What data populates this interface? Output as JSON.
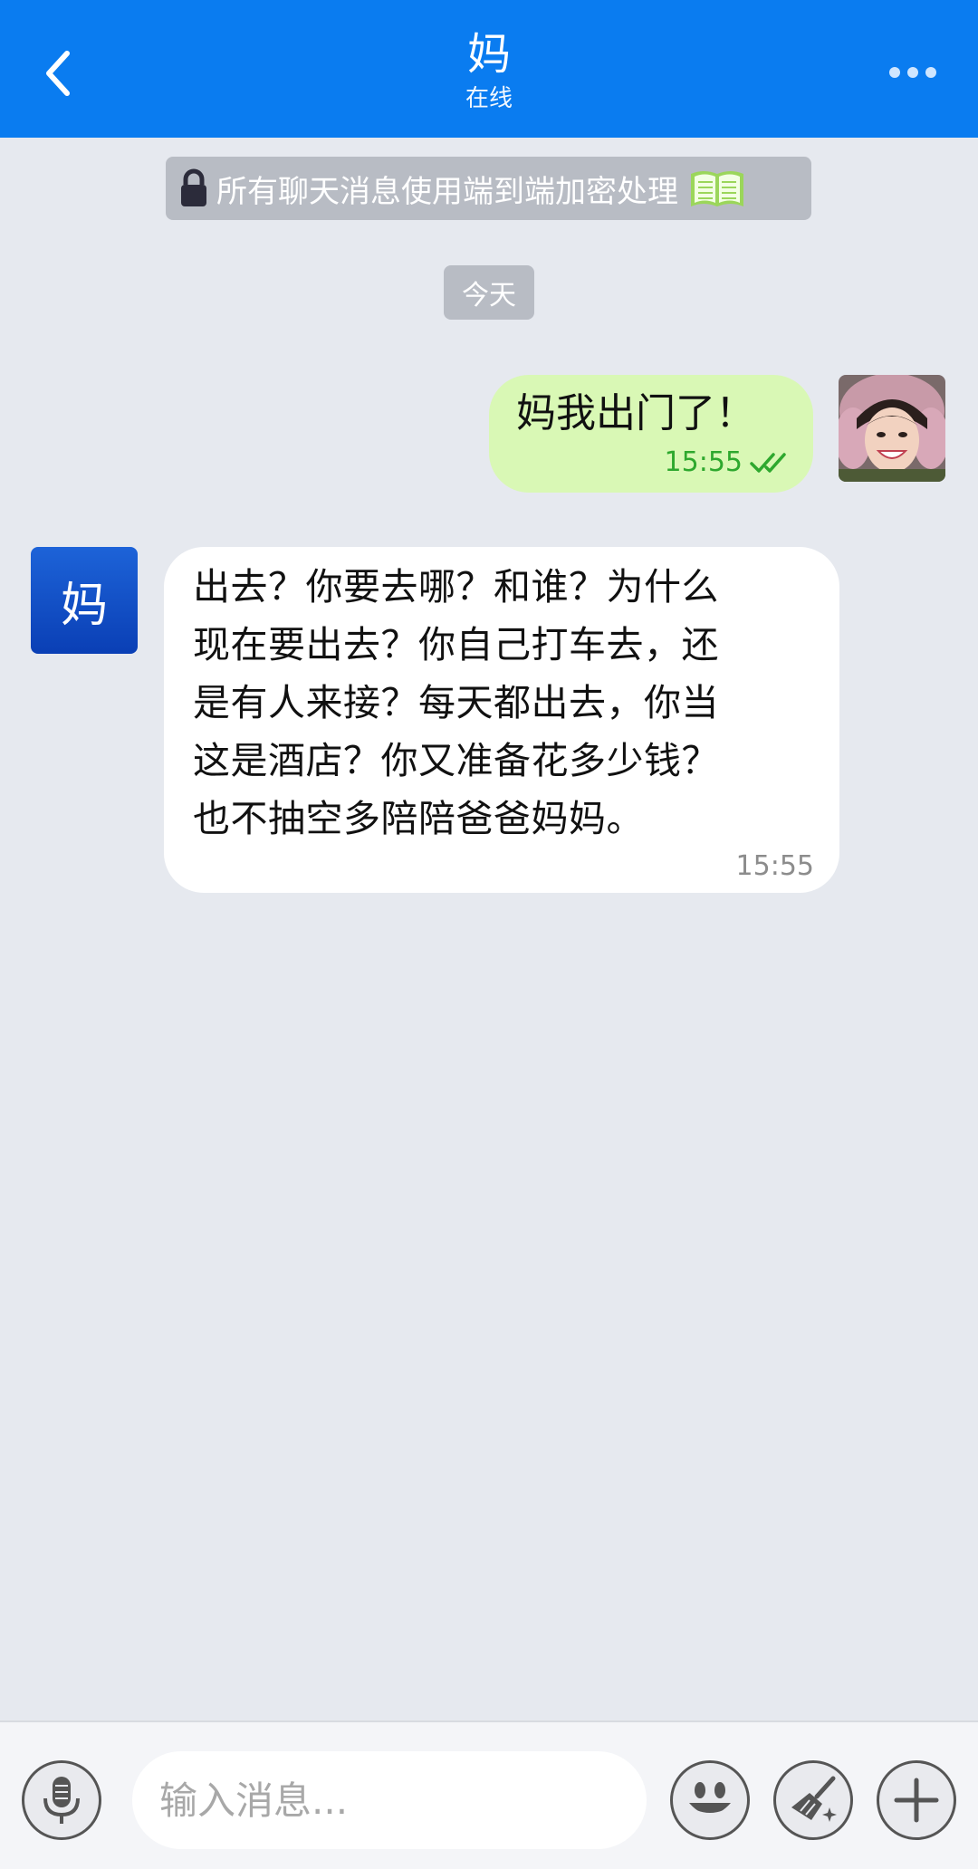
{
  "header": {
    "title": "妈",
    "status": "在线",
    "bg_color": "#0a7cf0"
  },
  "banner": {
    "text": "所有聊天消息使用端到端加密处理",
    "icons": [
      "lock-icon",
      "book-icon"
    ]
  },
  "date_chip": "今天",
  "messages": [
    {
      "direction": "outgoing",
      "text": "妈我出门了！",
      "time": "15:55",
      "status": "read",
      "bubble_color": "#d9f8b5"
    },
    {
      "direction": "incoming",
      "sender_avatar_text": "妈",
      "text": "出去？你要去哪？和谁？为什么\n现在要出去？你自己打车去，还\n是有人来接？每天都出去，你当\n这是酒店？你又准备花多少钱？\n也不抽空多陪陪爸爸妈妈。",
      "time": "15:55",
      "bubble_color": "#ffffff"
    }
  ],
  "composer": {
    "placeholder": "输入消息..."
  }
}
